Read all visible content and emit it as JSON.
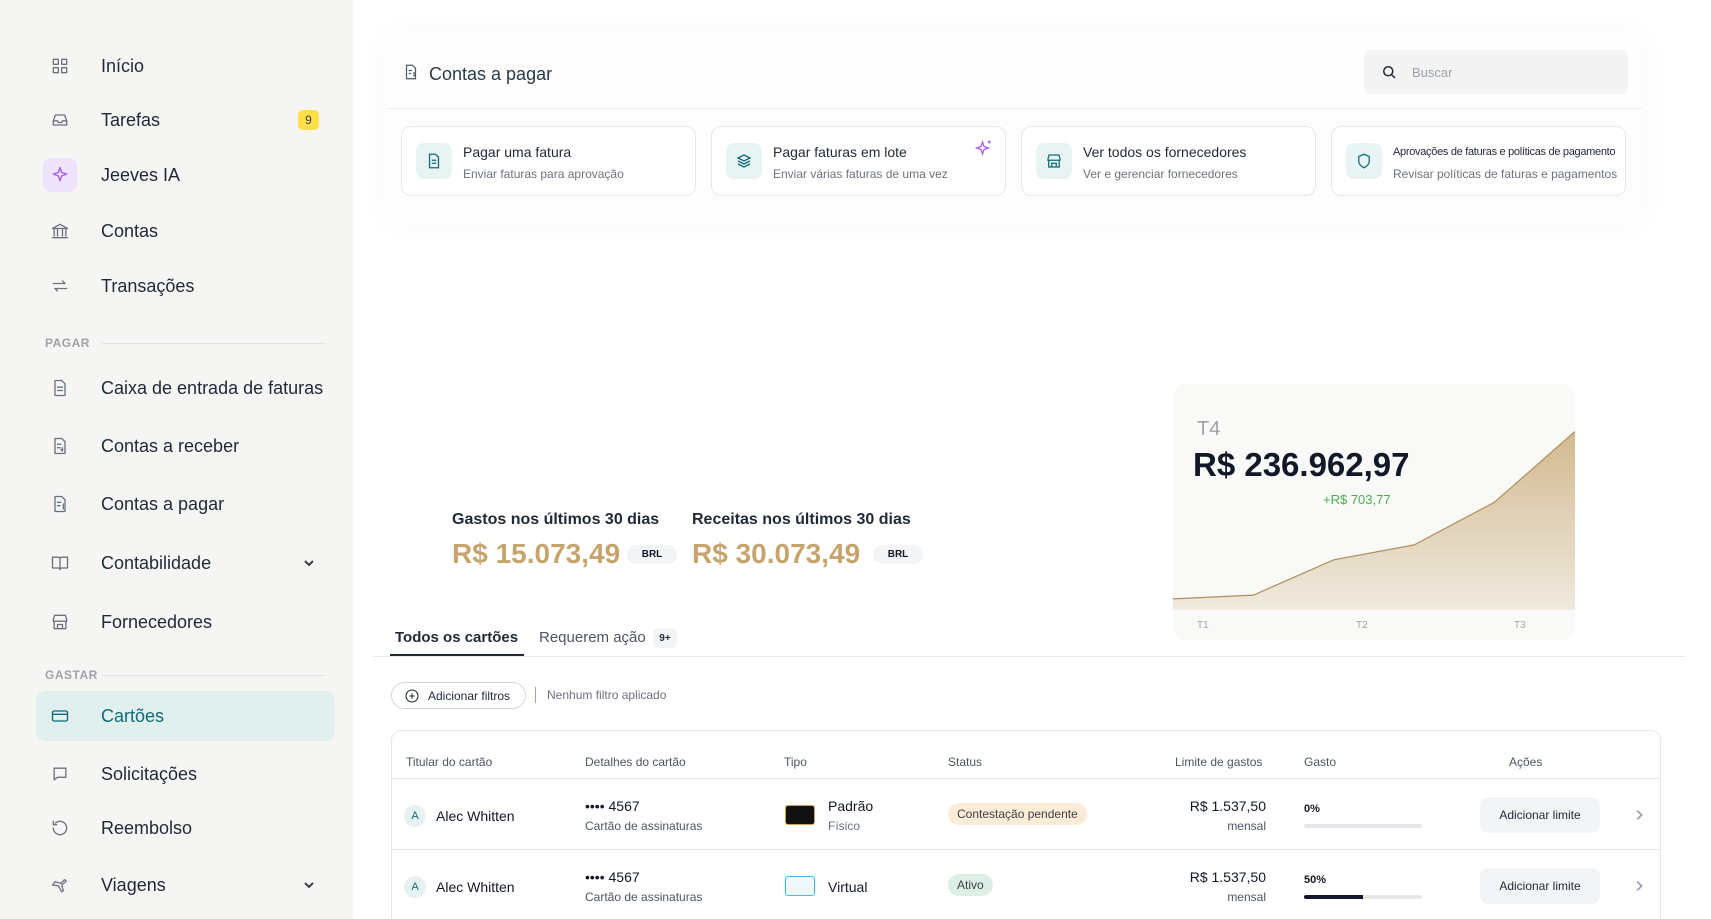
{
  "sidebar": {
    "items": [
      {
        "label": "Início",
        "icon": "grid-icon"
      },
      {
        "label": "Tarefas",
        "icon": "inbox-icon",
        "badge": "9"
      },
      {
        "label": "Jeeves IA",
        "icon": "sparkle-icon"
      },
      {
        "label": "Contas",
        "icon": "bank-icon"
      },
      {
        "label": "Transações",
        "icon": "transfer-icon"
      }
    ],
    "section_pay": "PAGAR",
    "pay_items": [
      {
        "label": "Caixa de entrada de faturas",
        "icon": "document-icon"
      },
      {
        "label": "Contas a receber",
        "icon": "receivable-icon"
      },
      {
        "label": "Contas a pagar",
        "icon": "payable-icon"
      },
      {
        "label": "Contabilidade",
        "icon": "book-icon"
      },
      {
        "label": "Fornecedores",
        "icon": "store-icon"
      }
    ],
    "section_spend": "GASTAR",
    "spend_items": [
      {
        "label": "Cartões",
        "icon": "card-icon"
      },
      {
        "label": "Solicitações",
        "icon": "chat-icon"
      },
      {
        "label": "Reembolso",
        "icon": "refund-icon"
      },
      {
        "label": "Viagens",
        "icon": "plane-icon"
      }
    ]
  },
  "header": {
    "title": "Contas a pagar",
    "search_placeholder": "Buscar"
  },
  "quick_actions": [
    {
      "title": "Pagar uma fatura",
      "subtitle": "Enviar faturas para aprovação",
      "icon": "invoice-icon"
    },
    {
      "title": "Pagar faturas em lote",
      "subtitle": "Enviar várias faturas de uma vez",
      "icon": "layers-icon"
    },
    {
      "title": "Ver todos os fornecedores",
      "subtitle": "Ver e gerenciar fornecedores",
      "icon": "store-icon"
    },
    {
      "title": "Aprovações de faturas e políticas de pagamento",
      "subtitle": "Revisar políticas de faturas e pagamentos",
      "icon": "shield-icon"
    }
  ],
  "stats": {
    "spend_label": "Gastos nos últimos 30 dias",
    "spend_value": "R$ 15.073,49",
    "spend_currency": "BRL",
    "income_label": "Receitas nos últimos 30 dias",
    "income_value": "R$ 30.073,49",
    "income_currency": "BRL",
    "value_color": "#c5a46d"
  },
  "quarter_card": {
    "label": "T4",
    "value": "R$ 236.962,97",
    "delta": "+R$ 703,77",
    "delta_color": "#4caf50"
  },
  "chart_data": {
    "type": "area",
    "categories": [
      "T1",
      "T2",
      "T3"
    ],
    "x": [
      0,
      0.2,
      0.4,
      0.6,
      0.8,
      1.0
    ],
    "values": [
      0.06,
      0.08,
      0.27,
      0.35,
      0.58,
      0.96
    ],
    "ylim": [
      0,
      1
    ],
    "grid": false,
    "fill_color": "#c5a46d"
  },
  "tabs": [
    {
      "label": "Todos os cartões",
      "active": true
    },
    {
      "label": "Requerem ação",
      "count": "9+",
      "active": false
    }
  ],
  "filters": {
    "add_label": "Adicionar filtros",
    "status": "Nenhum filtro aplicado"
  },
  "table": {
    "columns": [
      "Titular do cartão",
      "Detalhes do cartão",
      "Tipo",
      "Status",
      "Limite de gastos",
      "Gasto",
      "Ações"
    ],
    "rows": [
      {
        "initial": "A",
        "holder": "Alec Whitten",
        "card_number": "•••• 4567",
        "card_desc": "Cartão de assinaturas",
        "type": "Padrão",
        "type_sub": "Físico",
        "type_style": "physical",
        "status": "Contestação pendente",
        "status_color": "#fbecd8",
        "limit": "R$ 1.537,50",
        "limit_period": "mensal",
        "spent_label": "0%",
        "spent": 0,
        "action": "Adicionar limite"
      },
      {
        "initial": "A",
        "holder": "Alec Whitten",
        "card_number": "•••• 4567",
        "card_desc": "Cartão de assinaturas",
        "type": "Virtual",
        "type_sub": "",
        "type_style": "virtual",
        "status": "Ativo",
        "status_color": "#dcefe4",
        "limit": "R$ 1.537,50",
        "limit_period": "mensal",
        "spent_label": "50%",
        "spent": 0.5,
        "action": "Adicionar limite"
      }
    ]
  }
}
